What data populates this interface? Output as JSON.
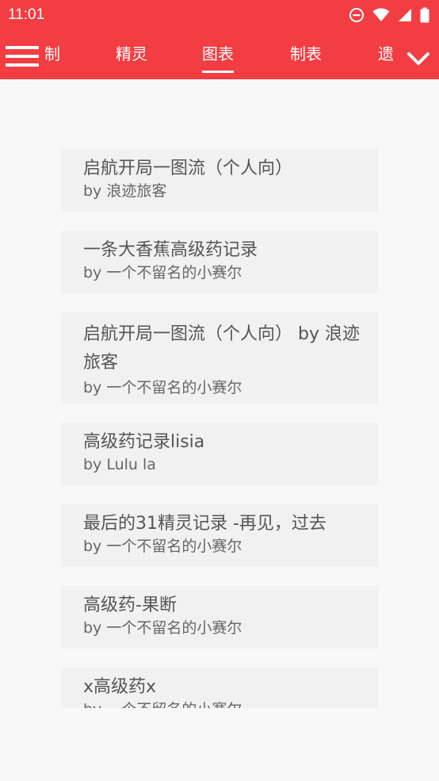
{
  "status_bar": {
    "time": "11:01",
    "icons": [
      "do-not-disturb-icon",
      "wifi-icon",
      "signal-icon",
      "battery-icon"
    ]
  },
  "tabbar": {
    "tabs": [
      {
        "label": "制",
        "active": false
      },
      {
        "label": "精灵",
        "active": false
      },
      {
        "label": "图表",
        "active": true
      },
      {
        "label": "制表",
        "active": false
      },
      {
        "label": "遗",
        "active": false
      }
    ],
    "menu_icon": "hamburger-menu-icon",
    "expand_icon": "chevron-down-icon"
  },
  "colors": {
    "accent": "#f23d42",
    "background": "#f8f8f8",
    "card": "#f1f1f1",
    "title_text": "#555555",
    "author_text": "#666666"
  },
  "items": [
    {
      "title": "启航开局一图流（个人向）",
      "author": "by 浪迹旅客"
    },
    {
      "title": "一条大香蕉高级药记录",
      "author": "by 一个不留名的小赛尔"
    },
    {
      "title": "启航开局一图流（个人向） by 浪迹旅客",
      "author": "by 一个不留名的小赛尔"
    },
    {
      "title": "高级药记录lisia",
      "author": "by Lulu la"
    },
    {
      "title": "最后的31精灵记录 -再见，过去",
      "author": "by 一个不留名的小赛尔"
    },
    {
      "title": "高级药-果断",
      "author": "by 一个不留名的小赛尔"
    },
    {
      "title": "x高级药x",
      "author": "by 一个不留名的小赛尔"
    }
  ]
}
